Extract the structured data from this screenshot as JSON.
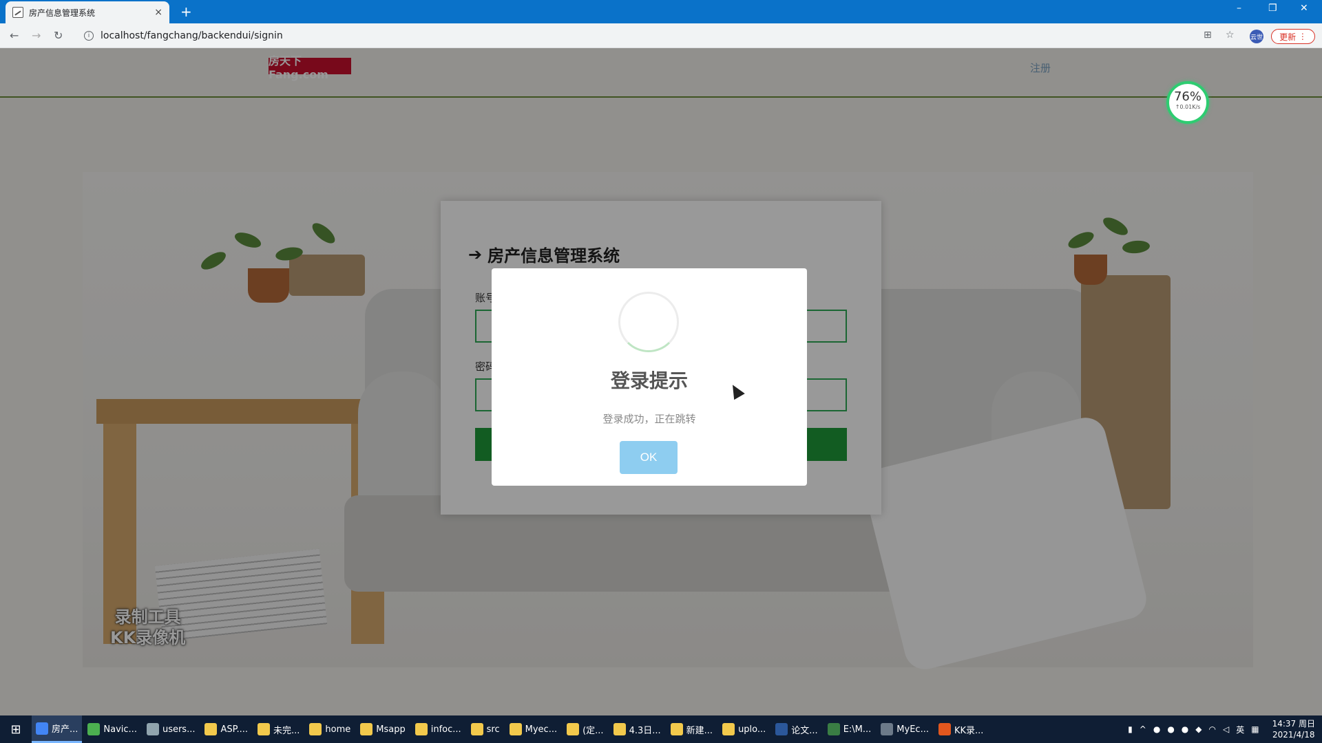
{
  "browser": {
    "tab_title": "房产信息管理系统",
    "tab_close": "×",
    "new_tab": "+",
    "url": "localhost/fangchang/backendui/signin",
    "profile_label": "云世",
    "update_label": "更新",
    "window_controls": [
      "–",
      "❐",
      "✕"
    ]
  },
  "site": {
    "logo_text": "房天下Fang.com",
    "register_link": "注册",
    "speed_percent": "76%",
    "speed_rate": "↑0.01K/s"
  },
  "login": {
    "title": "房产信息管理系统",
    "account_label": "账号",
    "password_label": "密码"
  },
  "modal": {
    "title": "登录提示",
    "message": "登录成功，正在跳转",
    "ok_label": "OK"
  },
  "watermark": {
    "line1": "录制工具",
    "line2": "KK录像机"
  },
  "taskbar": {
    "items": [
      {
        "label": "房产...",
        "icon": "chrome-icon",
        "color": "#4285f4"
      },
      {
        "label": "Navic...",
        "icon": "navicat-icon",
        "color": "#4caf50"
      },
      {
        "label": "users...",
        "icon": "users-icon",
        "color": "#90a4ae"
      },
      {
        "label": "ASP....",
        "icon": "folder-icon",
        "color": "#f2c94c"
      },
      {
        "label": "未完...",
        "icon": "folder-icon",
        "color": "#f2c94c"
      },
      {
        "label": "home",
        "icon": "folder-icon",
        "color": "#f2c94c"
      },
      {
        "label": "Msapp",
        "icon": "folder-icon",
        "color": "#f2c94c"
      },
      {
        "label": "infoc...",
        "icon": "folder-icon",
        "color": "#f2c94c"
      },
      {
        "label": "src",
        "icon": "folder-icon",
        "color": "#f2c94c"
      },
      {
        "label": "Myec...",
        "icon": "folder-icon",
        "color": "#f2c94c"
      },
      {
        "label": "(定...",
        "icon": "folder-icon",
        "color": "#f2c94c"
      },
      {
        "label": "4.3日...",
        "icon": "folder-icon",
        "color": "#f2c94c"
      },
      {
        "label": "新建...",
        "icon": "folder-icon",
        "color": "#f2c94c"
      },
      {
        "label": "uplo...",
        "icon": "folder-icon",
        "color": "#f2c94c"
      },
      {
        "label": "论文...",
        "icon": "word-icon",
        "color": "#2b579a"
      },
      {
        "label": "E:\\M...",
        "icon": "notepad-icon",
        "color": "#3a7d44"
      },
      {
        "label": "MyEc...",
        "icon": "myeclipse-icon",
        "color": "#6c7a89"
      },
      {
        "label": "KK录...",
        "icon": "kk-recorder-icon",
        "color": "#e2571e"
      }
    ],
    "tray_ime": "英",
    "clock_time": "14:37 周日",
    "clock_date": "2021/4/18"
  }
}
